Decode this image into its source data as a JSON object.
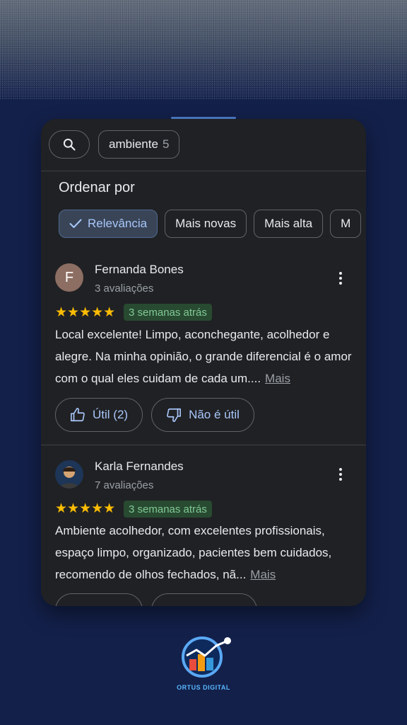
{
  "filter": {
    "chip_label": "ambiente",
    "chip_count": "5"
  },
  "sort": {
    "title": "Ordenar por",
    "options": [
      "Relevância",
      "Mais novas",
      "Mais alta",
      "M"
    ]
  },
  "reviews": [
    {
      "avatar_letter": "F",
      "author": "Fernanda Bones",
      "count": "3 avaliações",
      "stars": "★★★★★",
      "date": "3 semanas atrás",
      "text": "Local excelente! Limpo, aconchegante, acolhedor e alegre. Na minha opinião, o grande diferencial é o amor com o qual eles cuidam de cada um....",
      "more": "Mais",
      "helpful": "Útil (2)",
      "not_helpful": "Não é útil"
    },
    {
      "author": "Karla Fernandes",
      "count": "7 avaliações",
      "stars": "★★★★★",
      "date": "3 semanas atrás",
      "text": "Ambiente acolhedor, com excelentes profissionais, espaço limpo, organizado, pacientes bem cuidados, recomendo de olhos fechados, nã...",
      "more": "Mais"
    }
  ],
  "brand": {
    "name": "ORTUS DIGITAL"
  },
  "colors": {
    "background": "#13204a",
    "panel": "#202124",
    "accent": "#a8c7fa",
    "star": "#fbbc04",
    "date_badge": "#284a31"
  }
}
